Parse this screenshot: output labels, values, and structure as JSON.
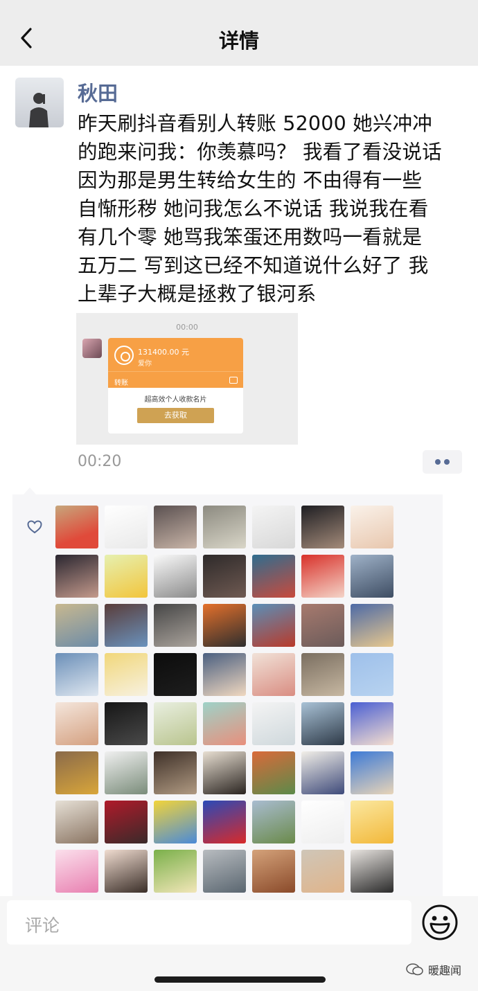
{
  "nav": {
    "title": "详情",
    "back_icon": "chevron-left-icon"
  },
  "post": {
    "author": "秋田",
    "text_lines": [
      "昨天刷抖音看别人转账 52000  她兴冲冲",
      "的跑来问我：你羡慕吗？ 我看了看没说话",
      "  因为那是男生转给女生的  不由得有一些",
      "自惭形秽  她问我怎么不说话  我说我在看",
      "有几个零  她骂我笨蛋还用数吗一看就是",
      "五万二  写到这已经不知道说什么好了  我",
      "上辈子大概是拯救了银河系"
    ],
    "time": "00:20"
  },
  "screenshot": {
    "time": "00:00",
    "amount": "131400.00 元",
    "note": "爱你",
    "type": "转账",
    "ad_text": "超高效个人收款名片",
    "button": "去获取",
    "colors": {
      "card": "#f7a045",
      "button": "#cfa253"
    }
  },
  "likes": {
    "heart_icon": "heart-outline-icon",
    "count_shown": 56,
    "avatars": [
      {
        "name": "bald-cartoon-kid-avatar",
        "bg": "linear-gradient(160deg,#c7a67c,#e04a3a 70%)"
      },
      {
        "name": "line-sketch-boy-avatar",
        "bg": "linear-gradient(160deg,#ffffff,#e9e9e9)"
      },
      {
        "name": "girl-selfie-avatar",
        "bg": "linear-gradient(160deg,#5a5050,#c9b5a8)"
      },
      {
        "name": "chandelier-avatar",
        "bg": "linear-gradient(160deg,#8c8a80,#d9d6c8)"
      },
      {
        "name": "sketch-figure-avatar",
        "bg": "linear-gradient(160deg,#f4f4f4,#d8d8d8)"
      },
      {
        "name": "dark-hair-girl-avatar",
        "bg": "linear-gradient(160deg,#1e1e22,#a48b7a)"
      },
      {
        "name": "anime-girl-avatar",
        "bg": "linear-gradient(160deg,#faf2ea,#e8c7ae)"
      },
      {
        "name": "girl-black-hair-avatar",
        "bg": "linear-gradient(160deg,#2a2630,#c49a8c)"
      },
      {
        "name": "yellow-chick-avatar",
        "bg": "linear-gradient(160deg,#e6f0b0,#f2c53c)"
      },
      {
        "name": "manga-boy-avatar",
        "bg": "linear-gradient(160deg,#fafafa,#8b8b8b)"
      },
      {
        "name": "dark-figure-avatar",
        "bg": "linear-gradient(160deg,#2e2a2a,#6f5a52)"
      },
      {
        "name": "astronaut-roses-avatar",
        "bg": "linear-gradient(160deg,#2f6d8f,#c94a3c)"
      },
      {
        "name": "flag-avatar",
        "bg": "linear-gradient(160deg,#d8312a,#f4d4c8)"
      },
      {
        "name": "snowy-mountain-avatar",
        "bg": "linear-gradient(160deg,#9fb2c8,#3e4d63)"
      },
      {
        "name": "flower-wall-avatar",
        "bg": "linear-gradient(160deg,#c8b88f,#6d8ca8)"
      },
      {
        "name": "shark-hoodie-avatar",
        "bg": "linear-gradient(160deg,#5a3d3a,#6a92bd)"
      },
      {
        "name": "man-portrait-avatar",
        "bg": "linear-gradient(160deg,#464646,#aaa39c)"
      },
      {
        "name": "orange-cat-avatar",
        "bg": "linear-gradient(160deg,#e4702b,#2e2e2e)"
      },
      {
        "name": "red-landscape-avatar",
        "bg": "linear-gradient(160deg,#5a8fb8,#b93a2a)"
      },
      {
        "name": "hand-cat-avatar",
        "bg": "linear-gradient(160deg,#a77a6e,#6b5b5a)"
      },
      {
        "name": "anime-spiky-avatar",
        "bg": "linear-gradient(160deg,#4d6aa6,#e8c88e)"
      },
      {
        "name": "blue-sky-avatar",
        "bg": "linear-gradient(160deg,#6b8fb8,#dfe7f0)"
      },
      {
        "name": "blonde-anime-avatar",
        "bg": "linear-gradient(160deg,#f1d77a,#f7f1e0)"
      },
      {
        "name": "black-bear-avatar",
        "bg": "linear-gradient(160deg,#0c0c0c,#1e1e1e)"
      },
      {
        "name": "anime-boy-avatar",
        "bg": "linear-gradient(160deg,#4a5f80,#f0d8c0)"
      },
      {
        "name": "laughing-baby-avatar",
        "bg": "linear-gradient(160deg,#f1e2d8,#d98d82)"
      },
      {
        "name": "statue-avatar",
        "bg": "linear-gradient(160deg,#7a6e60,#c7b8a2)"
      },
      {
        "name": "light-blue-avatar",
        "bg": "linear-gradient(160deg,#9ec0ea,#b8d3f0)"
      },
      {
        "name": "mask-boy-avatar",
        "bg": "linear-gradient(160deg,#f4e6dc,#d4a080)"
      },
      {
        "name": "dark-hand-avatar",
        "bg": "linear-gradient(160deg,#161616,#4a4a4a)"
      },
      {
        "name": "girl-corgi-avatar",
        "bg": "linear-gradient(160deg,#e9efe0,#b9c48e)"
      },
      {
        "name": "cartoon-laughing-avatar",
        "bg": "linear-gradient(160deg,#9ed2c8,#e88f7c)"
      },
      {
        "name": "white-hair-anime-avatar",
        "bg": "linear-gradient(160deg,#f4f4f4,#cfd8dc)"
      },
      {
        "name": "seaside-man-avatar",
        "bg": "linear-gradient(160deg,#a9c2d6,#2e3a48)"
      },
      {
        "name": "blue-hair-anime-avatar",
        "bg": "linear-gradient(160deg,#4a5fd2,#f6dfd0)"
      },
      {
        "name": "helmet-figure-avatar",
        "bg": "linear-gradient(160deg,#8a6a4a,#d9a63a)"
      },
      {
        "name": "blindfold-boy-avatar",
        "bg": "linear-gradient(160deg,#f0f0f0,#7a8c7a)"
      },
      {
        "name": "cap-boy-avatar",
        "bg": "linear-gradient(160deg,#3e3028,#b09a82)"
      },
      {
        "name": "long-hair-girl-avatar",
        "bg": "linear-gradient(160deg,#e8dfd2,#2a2420)"
      },
      {
        "name": "kim-possible-avatar",
        "bg": "linear-gradient(160deg,#d96a3a,#5c8a4a)"
      },
      {
        "name": "boy-illustration-avatar",
        "bg": "linear-gradient(160deg,#f2efe8,#3e4a7a)"
      },
      {
        "name": "cartoon-blue-boy-avatar",
        "bg": "linear-gradient(160deg,#3d7ad6,#e8d4b8)"
      },
      {
        "name": "cat-avatar",
        "bg": "linear-gradient(160deg,#e6e0d6,#8a7462)"
      },
      {
        "name": "red-hair-girl-avatar",
        "bg": "linear-gradient(160deg,#b01a2a,#3a2a2a)"
      },
      {
        "name": "bart-simpson-avatar",
        "bg": "linear-gradient(160deg,#f2d43a,#4a8ad8)"
      },
      {
        "name": "elmo-avatar",
        "bg": "linear-gradient(160deg,#2a4ab8,#d82a2a)"
      },
      {
        "name": "field-figure-avatar",
        "bg": "linear-gradient(160deg,#a9bcd0,#6a8a4a)"
      },
      {
        "name": "white-dino-avatar",
        "bg": "linear-gradient(160deg,#ffffff,#eeeeee)"
      },
      {
        "name": "yellow-emoji-avatar",
        "bg": "linear-gradient(160deg,#fbe8a0,#f2b83a)"
      },
      {
        "name": "kawaii-heart-avatar",
        "bg": "linear-gradient(160deg,#fbe0ec,#e87fb0)"
      },
      {
        "name": "little-girl-avatar",
        "bg": "linear-gradient(160deg,#f0dcd0,#3a2e28)"
      },
      {
        "name": "train-cartoon-avatar",
        "bg": "linear-gradient(160deg,#7ab04a,#f2e6b8)"
      },
      {
        "name": "corridor-avatar",
        "bg": "linear-gradient(160deg,#b8bcc0,#5a6670)"
      },
      {
        "name": "teddy-bear-avatar",
        "bg": "linear-gradient(160deg,#d4a27a,#8a4a2a)"
      },
      {
        "name": "hat-girl-avatar",
        "bg": "linear-gradient(160deg,#cfc6b8,#e0b48a)"
      },
      {
        "name": "masked-man-avatar",
        "bg": "linear-gradient(160deg,#e8e4e0,#2a2a2a)"
      }
    ]
  },
  "comment": {
    "placeholder": "评论",
    "emoji_icon": "smiley-icon"
  },
  "watermark": {
    "text": "暖趣闻"
  }
}
